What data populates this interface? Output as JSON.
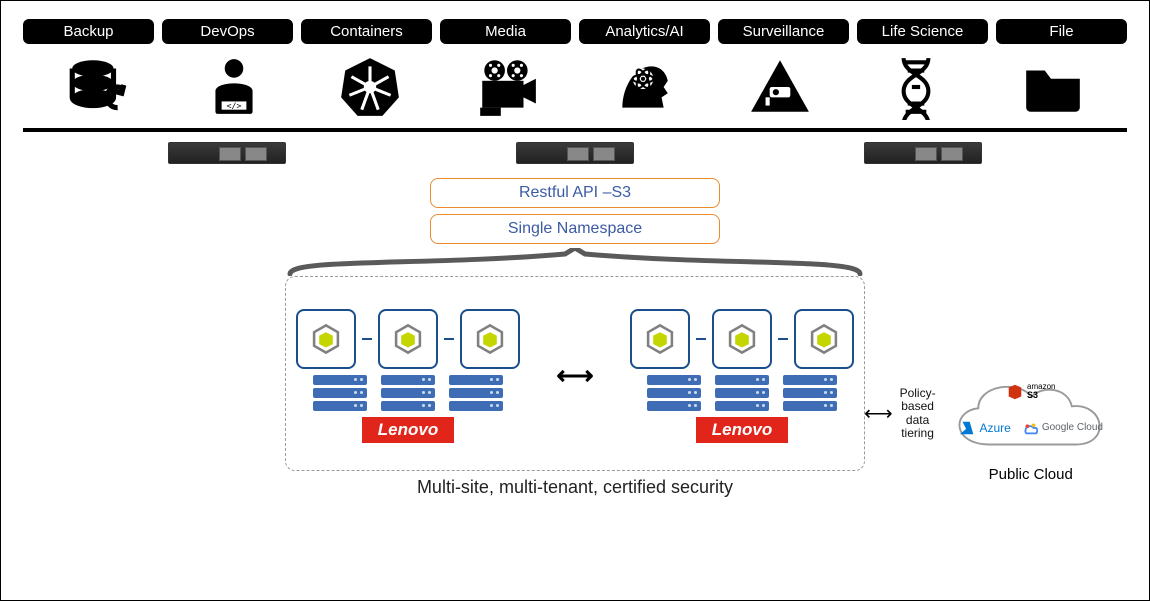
{
  "pills": [
    "Backup",
    "DevOps",
    "Containers",
    "Media",
    "Analytics/AI",
    "Surveillance",
    "Life Science",
    "File"
  ],
  "api": {
    "rest": "Restful API –S3",
    "ns": "Single Namespace"
  },
  "vendor": "Lenovo",
  "tier": "Policy-\nbased\ndata\ntiering",
  "cloud": {
    "caption": "Public Cloud",
    "providers": {
      "s3a": "amazon",
      "s3b": "S3",
      "azure": "Azure",
      "gcp": "Google Cloud"
    }
  },
  "caption": "Multi-site, multi-tenant, certified security"
}
